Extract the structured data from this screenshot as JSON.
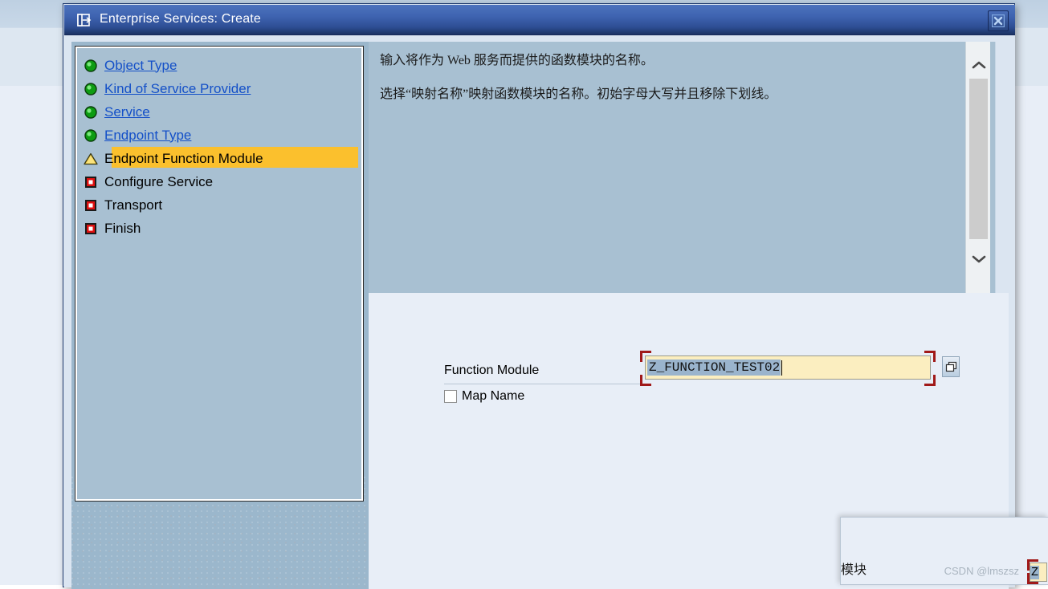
{
  "window": {
    "title": "Enterprise Services: Create",
    "title_icon": "dialog-export-icon",
    "close_icon": "close-icon"
  },
  "steps": [
    {
      "label": "Object Type",
      "state": "done",
      "icon": "green-circle-icon"
    },
    {
      "label": "Kind of Service Provider",
      "state": "done",
      "icon": "green-circle-icon"
    },
    {
      "label": "Service",
      "state": "done",
      "icon": "green-circle-icon"
    },
    {
      "label": "Endpoint Type",
      "state": "done",
      "icon": "green-circle-icon"
    },
    {
      "label": "Endpoint Function Module",
      "state": "current",
      "icon": "yellow-triangle-icon"
    },
    {
      "label": "Configure Service",
      "state": "pending",
      "icon": "red-square-icon"
    },
    {
      "label": "Transport",
      "state": "pending",
      "icon": "red-square-icon"
    },
    {
      "label": "Finish",
      "state": "pending",
      "icon": "red-square-icon"
    }
  ],
  "info": {
    "line1": "输入将作为 Web 服务而提供的函数模块的名称。",
    "line2": "选择“映射名称”映射函数模块的名称。初始字母大写并且移除下划线。",
    "scrollbar": {
      "up_icon": "chevron-up-icon",
      "down_icon": "chevron-down-icon"
    }
  },
  "form": {
    "function_module_label": "Function Module",
    "function_module_value": "Z_FUNCTION_TEST02",
    "function_module_placeholder": "",
    "value_help_icon": "value-help-icon",
    "map_name_label": "Map Name",
    "map_name_checked": false
  },
  "overlay": {
    "text": "模块",
    "input_value": "Z",
    "watermark": "CSDN @lmszsz"
  },
  "colors": {
    "titlebar_top": "#4d73bd",
    "titlebar_bottom": "#1b3263",
    "panel_blue": "#a8c0d2",
    "highlight_yellow": "#fbc02d",
    "input_yellow": "#fbeec0",
    "selection_blue": "#9ab4cd",
    "focus_red": "#a01919",
    "link_blue": "#1450c8"
  }
}
